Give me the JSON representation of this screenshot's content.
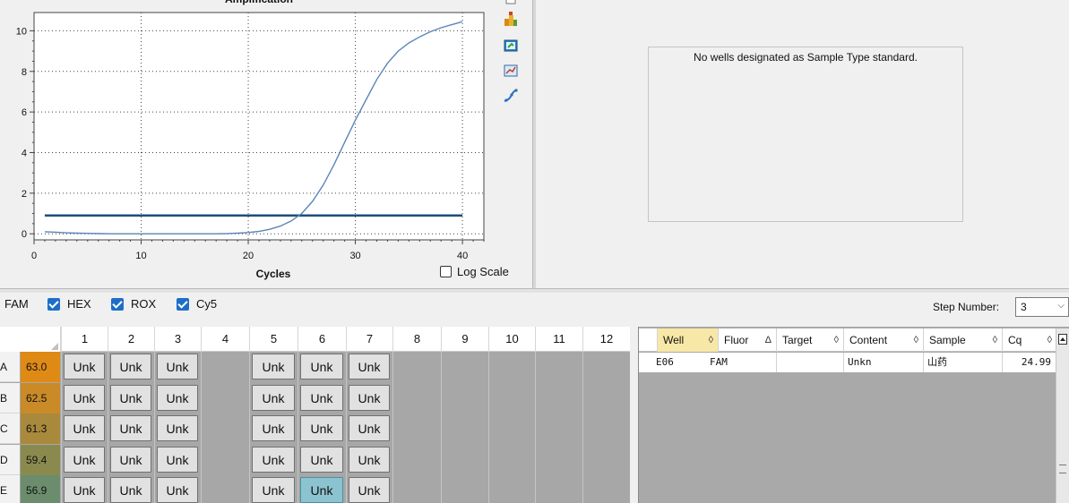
{
  "chart": {
    "title": "Amplification",
    "xlabel": "Cycles",
    "log_scale_label": "Log Scale",
    "log_scale_checked": false
  },
  "chart_data": {
    "type": "line",
    "title": "Amplification",
    "xlabel": "Cycles",
    "ylabel": "",
    "xlim": [
      0,
      42
    ],
    "ylim": [
      -0.3,
      10.9
    ],
    "x_ticks": [
      0,
      10,
      20,
      30,
      40
    ],
    "y_ticks": [
      0,
      2,
      4,
      6,
      8,
      10
    ],
    "grid": true,
    "series": [
      {
        "color": "#5b86b8",
        "x": [
          1,
          2,
          3,
          4,
          5,
          6,
          7,
          8,
          9,
          10,
          11,
          12,
          13,
          14,
          15,
          16,
          17,
          18,
          19,
          20,
          21,
          22,
          23,
          24,
          25,
          26,
          27,
          28,
          29,
          30,
          31,
          32,
          33,
          34,
          35,
          36,
          37,
          38,
          39,
          40
        ],
        "y": [
          0.1,
          0.08,
          0.05,
          0.03,
          0.02,
          0.01,
          0.0,
          0.0,
          0.0,
          0.0,
          0.0,
          0.0,
          0.0,
          0.0,
          0.0,
          0.0,
          0.0,
          0.01,
          0.03,
          0.06,
          0.12,
          0.22,
          0.38,
          0.63,
          1.0,
          1.6,
          2.4,
          3.4,
          4.5,
          5.6,
          6.6,
          7.6,
          8.4,
          9.0,
          9.4,
          9.7,
          9.95,
          10.15,
          10.3,
          10.45
        ]
      }
    ],
    "threshold": {
      "y": 0.9,
      "x_start": 1,
      "x_end": 40,
      "color": "#1f4e79"
    }
  },
  "toolbar_icons": [
    "chart-settings-icon",
    "export-icon",
    "print-icon",
    "zoom-icon",
    "curve-fit-icon"
  ],
  "standard_curve": {
    "message": "No wells designated as Sample Type standard."
  },
  "filters": {
    "fluors": [
      {
        "label": "FAM",
        "checked": true
      },
      {
        "label": "HEX",
        "checked": true
      },
      {
        "label": "ROX",
        "checked": true
      },
      {
        "label": "Cy5",
        "checked": true
      }
    ],
    "step_label": "Step Number:",
    "step_value": "3"
  },
  "plate": {
    "columns": [
      "1",
      "2",
      "3",
      "4",
      "5",
      "6",
      "7",
      "8",
      "9",
      "10",
      "11",
      "12"
    ],
    "rows": [
      {
        "label": "A",
        "temp": "63.0",
        "temp_color": "#e08a16",
        "wells": [
          "Unk",
          "Unk",
          "Unk",
          "",
          "Unk",
          "Unk",
          "Unk",
          "",
          "",
          "",
          "",
          ""
        ]
      },
      {
        "label": "B",
        "temp": "62.5",
        "temp_color": "#c98a27",
        "wells": [
          "Unk",
          "Unk",
          "Unk",
          "",
          "Unk",
          "Unk",
          "Unk",
          "",
          "",
          "",
          "",
          ""
        ]
      },
      {
        "label": "C",
        "temp": "61.3",
        "temp_color": "#a9893b",
        "wells": [
          "Unk",
          "Unk",
          "Unk",
          "",
          "Unk",
          "Unk",
          "Unk",
          "",
          "",
          "",
          "",
          ""
        ]
      },
      {
        "label": "D",
        "temp": "59.4",
        "temp_color": "#8a8a4f",
        "wells": [
          "Unk",
          "Unk",
          "Unk",
          "",
          "Unk",
          "Unk",
          "Unk",
          "",
          "",
          "",
          "",
          ""
        ]
      },
      {
        "label": "E",
        "temp": "56.9",
        "temp_color": "#6b8d6d",
        "wells": [
          "Unk",
          "Unk",
          "Unk",
          "",
          "Unk",
          "Unk",
          "Unk",
          "",
          "",
          "",
          "",
          ""
        ]
      }
    ],
    "selected": {
      "row": 4,
      "col": 5
    }
  },
  "results": {
    "headers": [
      "Well",
      "Fluor",
      "Target",
      "Content",
      "Sample",
      "Cq"
    ],
    "sort_glyphs": [
      "◊",
      "Δ",
      "◊",
      "◊",
      "◊",
      "◊"
    ],
    "rows": [
      {
        "well": "E06",
        "fluor": "FAM",
        "target": "",
        "content": "Unkn",
        "sample": "山药",
        "cq": "24.99"
      }
    ]
  }
}
